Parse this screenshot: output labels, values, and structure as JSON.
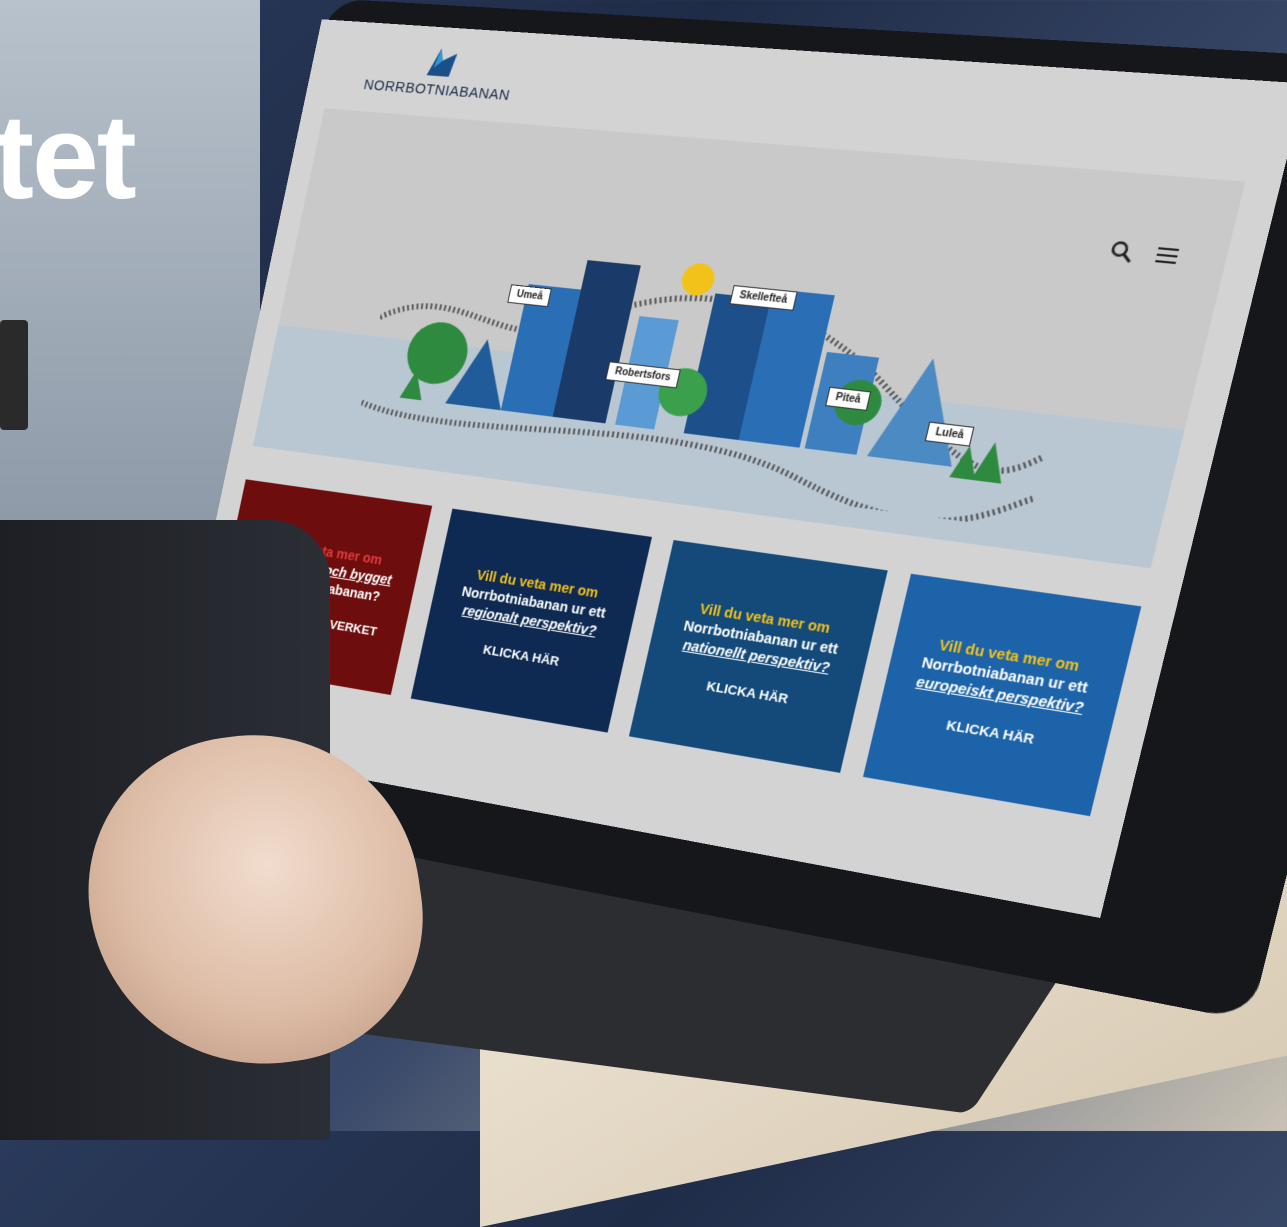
{
  "background": {
    "headline_fragment": "tet"
  },
  "site": {
    "name": "NORRBOTNIABANAN"
  },
  "header": {
    "search_icon": "search-icon",
    "menu_icon": "hamburger-menu-icon"
  },
  "hero": {
    "signs": [
      "Umeå",
      "Robertsfors",
      "Skellefteå",
      "Piteå",
      "Luleå"
    ]
  },
  "cards": [
    {
      "line1": "Vill du veta mer om",
      "topic": "planeringen och bygget",
      "line2": "av Norrbotniabanan?",
      "cta": "BESÖK TRAFIKVERKET",
      "bg": "#6e0d0d",
      "line1_color": "#e23b3b"
    },
    {
      "line1": "Vill du veta mer om",
      "line2": "Norrbotniabanan ur ett",
      "topic": "regionalt perspektiv?",
      "cta": "KLICKA HÄR",
      "bg": "#0e2a52",
      "line1_color": "#f2c21b"
    },
    {
      "line1": "Vill du veta mer om",
      "line2": "Norrbotniabanan ur ett",
      "topic": "nationellt perspektiv?",
      "cta": "KLICKA HÄR",
      "bg": "#134a7a",
      "line1_color": "#f2c21b"
    },
    {
      "line1": "Vill du veta mer om",
      "line2": "Norrbotniabanan ur ett",
      "topic": "europeiskt perspektiv?",
      "cta": "KLICKA HÄR",
      "bg": "#1d63aa",
      "line1_color": "#f2c21b"
    }
  ]
}
